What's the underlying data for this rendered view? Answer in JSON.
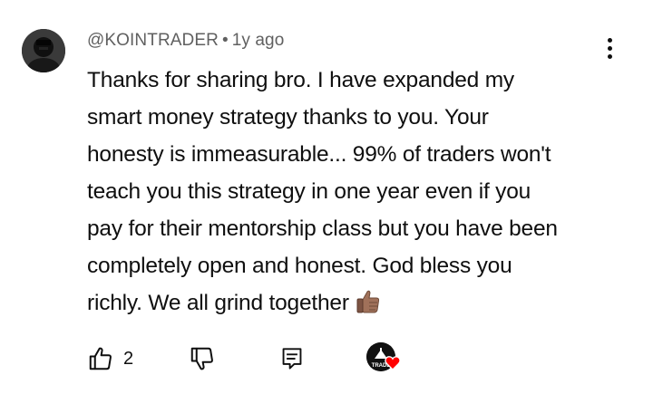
{
  "comment": {
    "author": "@KOINTRADER",
    "separator": "•",
    "time": "1y ago",
    "text_lines": [
      "Thanks for sharing bro. I have expanded my",
      "smart money strategy thanks to you. Your",
      "honesty is immeasurable... 99% of traders won't",
      "teach you this strategy in one year even if you",
      "pay for their mentorship class but you have been",
      "completely open and honest. God bless you",
      "richly. We all grind together"
    ],
    "emoji": "thumbs-up-medium-skin-tone",
    "like_count": "2",
    "creator_heart_label": "TRADE"
  },
  "icons": {
    "like": "thumbs-up-outline-icon",
    "dislike": "thumbs-down-outline-icon",
    "reply": "reply-comment-icon",
    "menu": "more-vertical-icon",
    "heart": "creator-heart-icon"
  },
  "colors": {
    "text": "#0f0f0f",
    "meta": "#606060",
    "heart": "#ff0000",
    "emoji_skin": "#a0715a"
  }
}
